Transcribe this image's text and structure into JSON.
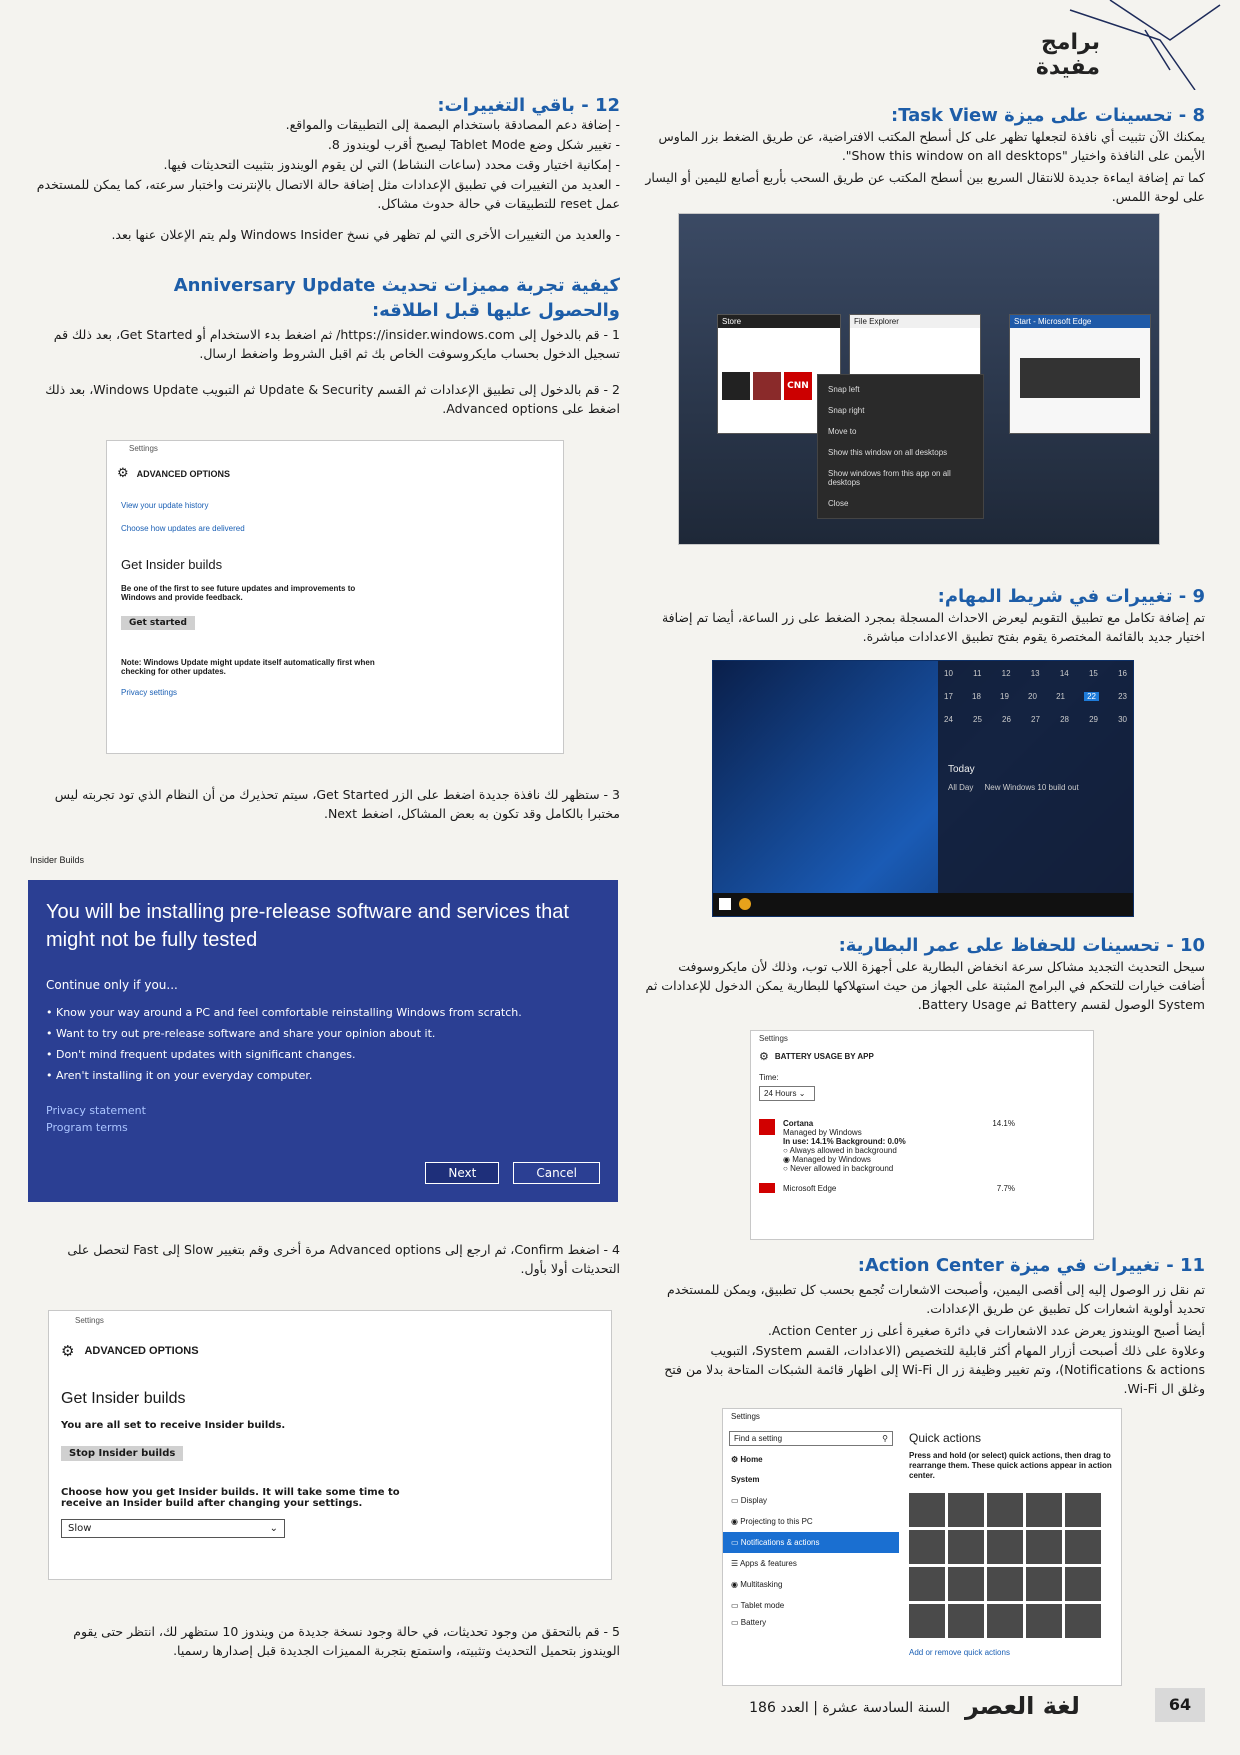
{
  "header": {
    "section_title": "برامج مفيدة",
    "magazine_name": "لغة العصر",
    "issue_info": "السنة السادسة عشرة | العدد 186",
    "page_number": "64"
  },
  "col_right": {
    "s8": {
      "title": "8 - تحسينات على ميزة Task View:",
      "p1": "يمكنك الآن تثبيت أي نافذة لتجعلها تظهر على كل أسطح المكتب الافتراضية، عن طريق الضغط بزر الماوس الأيمن على النافذة واختيار \"Show this window on all desktops\".",
      "p2": "كما تم إضافة ايماءة جديدة للانتقال السريع بين أسطح المكتب عن طريق السحب بأربع أصابع لليمين أو اليسار على لوحة اللمس."
    },
    "taskview_shot": {
      "windows": [
        "Store",
        "File Explorer",
        "Start - Microsoft Edge"
      ],
      "menu": [
        "Snap left",
        "Snap right",
        "Move to",
        "Show this window on all desktops",
        "Show windows from this app on all desktops",
        "Close"
      ],
      "cnn": "CNN"
    },
    "s9": {
      "title": "9 - تغييرات في شريط المهام:",
      "p1": "تم إضافة تكامل مع تطبيق التقويم ليعرض الاحداث المسجلة بمجرد الضغط على زر الساعة، أيضا تم إضافة اختيار جديد بالقائمة المختصرة يقوم بفتح تطبيق الاعدادات مباشرة."
    },
    "calendar_shot": {
      "row1": [
        "10",
        "11",
        "12",
        "13",
        "14",
        "15",
        "16"
      ],
      "row2": [
        "17",
        "18",
        "19",
        "20",
        "21",
        "22",
        "23"
      ],
      "row3": [
        "24",
        "25",
        "26",
        "27",
        "28",
        "29",
        "30"
      ],
      "today_label": "Today",
      "event_time": "All Day",
      "event_text": "New Windows 10 build out"
    },
    "s10": {
      "title": "10 - تحسينات للحفاظ على عمر البطارية:",
      "p1": "سيحل التحديث التجديد مشاكل سرعة انخفاض البطارية على أجهزة اللاب توب، وذلك لأن مايكروسوفت أضافت خيارات للتحكم في البرامج المثبتة على الجهاز من حيث استهلاكها للبطارية يمكن الدخول للإعدادات ثم System الوصول لقسم Battery ثم Battery Usage."
    },
    "battery_shot": {
      "window_title": "Settings",
      "heading": "BATTERY USAGE BY APP",
      "time_label": "Time:",
      "time_value": "24 Hours",
      "app_name": "Cortana",
      "app_pct": "14.1%",
      "managed": "Managed by Windows",
      "usage": "In use: 14.1% Background: 0.0%",
      "opt1": "Always allowed in background",
      "opt2": "Managed by Windows",
      "opt3": "Never allowed in background",
      "app2_name": "Microsoft Edge",
      "app2_pct": "7.7%"
    },
    "s11": {
      "title": "11 - تغييرات في ميزة Action Center:",
      "p1": "تم نقل زر الوصول إليه إلى أقصى اليمين، وأصبحت الاشعارات تُجمع بحسب كل تطبيق، ويمكن للمستخدم تحديد أولوية اشعارات كل تطبيق عن طريق الإعدادات.",
      "p2": "أيضا أصبح الويندوز يعرض عدد الاشعارات في دائرة صغيرة أعلى زر Action Center.",
      "p3": "وعلاوة على ذلك أصبحت أزرار المهام أكثر قابلية للتخصيص (الاعدادات، القسم System، التبويب Notifications & actions)، وتم تغيير وظيفة زر ال Wi-Fi إلى اظهار قائمة الشبكات المتاحة بدلا من فتح وغلق ال Wi-Fi."
    },
    "quick_shot": {
      "window_title": "Settings",
      "find": "Find a setting",
      "home": "Home",
      "system": "System",
      "nav": [
        "Display",
        "Projecting to this PC",
        "Notifications & actions",
        "Apps & features",
        "Multitasking",
        "Tablet mode",
        "Battery"
      ],
      "heading": "Quick actions",
      "desc": "Press and hold (or select) quick actions, then drag to rearrange them. These quick actions appear in action center.",
      "link": "Add or remove quick actions"
    }
  },
  "col_left": {
    "s12": {
      "title": "12 - باقي التغييرات:",
      "items": [
        "- إضافة دعم المصادقة باستخدام البصمة إلى التطبيقات والمواقع.",
        "- تغيير شكل وضع Tablet Mode ليصبح أقرب لويندوز 8.",
        "- إمكانية اختيار وقت محدد (ساعات النشاط) التي لن يقوم الويندوز بتثبيت التحديثات فيها.",
        "- العديد من التغييرات في تطبيق الإعدادات مثل إضافة حالة الاتصال بالإنترنت واختبار سرعته، كما يمكن للمستخدم عمل reset للتطبيقات في حالة حدوث مشاكل.",
        "- والعديد من التغييرات الأخرى التي لم تظهر في نسخ Windows Insider ولم يتم الإعلان عنها بعد."
      ]
    },
    "howto": {
      "title1": "كيفية تجربة مميزات تحديث Anniversary Update",
      "title2": "والحصول عليها قبل اطلاقه:",
      "step1": "1 - قم بالدخول إلى https://insider.windows.com/ ثم اضغط بدء الاستخدام أو Get Started، بعد ذلك قم تسجيل الدخول بحساب مايكروسوفت الخاص بك ثم اقبل الشروط واضغط ارسال.",
      "step2": "2 - قم بالدخول إلى تطبيق الإعدادات ثم القسم Update & Security ثم التبويب Windows Update، بعد ذلك اضغط على Advanced options.",
      "step3": "3 - ستظهر لك نافذة جديدة اضغط على الزر Get Started، سيتم تحذيرك من أن النظام الذي تود تجربته ليس مختبرا بالكامل وقد تكون به بعض المشاكل، اضغط Next.",
      "step4": "4 - اضغط Confirm، ثم ارجع إلى Advanced options مرة أخرى وقم بتغيير Slow إلى Fast لتحصل على التحديثات أولا بأول.",
      "step5": "5 - قم بالتحقق من وجود تحديثات، في حالة وجود نسخة جديدة من ويندوز 10 ستظهر لك، انتظر حتى يقوم الويندوز بتحميل التحديث وتثبيته، واستمتع بتجربة المميزات الجديدة قبل إصدارها رسميا."
    },
    "adv_shot": {
      "window_title": "Settings",
      "heading": "ADVANCED OPTIONS",
      "link1": "View your update history",
      "link2": "Choose how updates are delivered",
      "insider": "Get Insider builds",
      "desc": "Be one of the first to see future updates and improvements to Windows and provide feedback.",
      "btn": "Get started",
      "note": "Note: Windows Update might update itself automatically first when checking for other updates.",
      "privacy": "Privacy settings"
    },
    "insider_dialog": {
      "caption": "Insider Builds",
      "heading": "You will be installing pre-release software and services that might not be fully tested",
      "continue": "Continue only if you...",
      "bullets": [
        "• Know your way around a PC and feel comfortable reinstalling Windows from scratch.",
        "• Want to try out pre-release software and share your opinion about it.",
        "• Don't mind frequent updates with significant changes.",
        "• Aren't installing it on your everyday computer."
      ],
      "link1": "Privacy statement",
      "link2": "Program terms",
      "next": "Next",
      "cancel": "Cancel"
    },
    "adv2_shot": {
      "window_title": "Settings",
      "heading": "ADVANCED OPTIONS",
      "insider": "Get Insider builds",
      "set": "You are all set to receive Insider builds.",
      "btn": "Stop Insider builds",
      "choose": "Choose how you get Insider builds. It will take some time to receive an Insider build after changing your settings.",
      "select": "Slow"
    }
  }
}
